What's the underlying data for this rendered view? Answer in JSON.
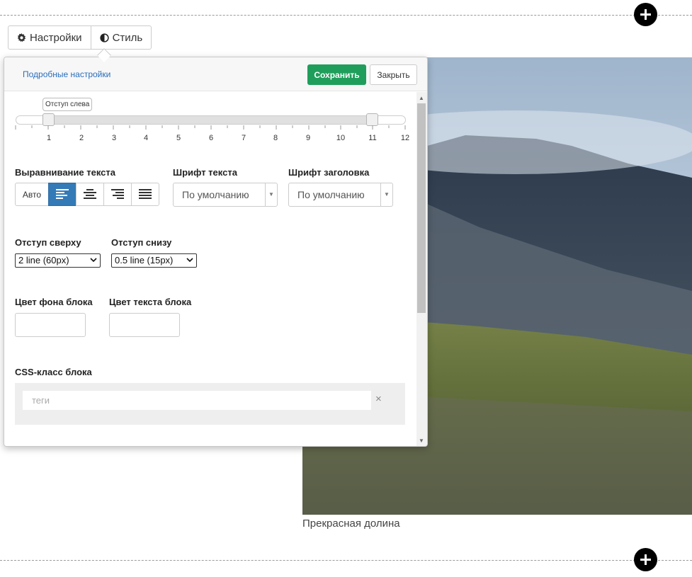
{
  "page": {
    "photo_caption": "Прекрасная долина"
  },
  "tabs": [
    {
      "label": "Настройки",
      "icon": "gear-icon"
    },
    {
      "label": "Стиль",
      "icon": "contrast-icon"
    }
  ],
  "panel": {
    "advanced_link": "Подробные настройки",
    "save_label": "Сохранить",
    "close_label": "Закрыть",
    "save_color": "#1f9e5b"
  },
  "indent_slider": {
    "tooltip": "Отступ слева",
    "ticks": [
      "1",
      "2",
      "3",
      "4",
      "5",
      "6",
      "7",
      "8",
      "9",
      "10",
      "11",
      "12"
    ],
    "range_start": 1,
    "range_end": 11
  },
  "text_align": {
    "label": "Выравнивание текста",
    "auto_label": "Авто",
    "options": [
      "align-left-icon",
      "align-center-icon",
      "align-right-icon",
      "align-justify-icon"
    ],
    "active": "align-left-icon",
    "active_color": "#337ab7"
  },
  "text_font": {
    "label": "Шрифт текста",
    "value": "По умолчанию"
  },
  "heading_font": {
    "label": "Шрифт заголовка",
    "value": "По умолчанию"
  },
  "padding_top": {
    "label": "Отступ сверху",
    "value": "2 line (60px)"
  },
  "padding_bottom": {
    "label": "Отступ снизу",
    "value": "0.5 line (15px)"
  },
  "bg_color": {
    "label": "Цвет фона блока",
    "value": ""
  },
  "text_color": {
    "label": "Цвет текста блока",
    "value": ""
  },
  "css_class": {
    "label": "CSS-класс блока",
    "placeholder": "теги",
    "clear": "×"
  }
}
